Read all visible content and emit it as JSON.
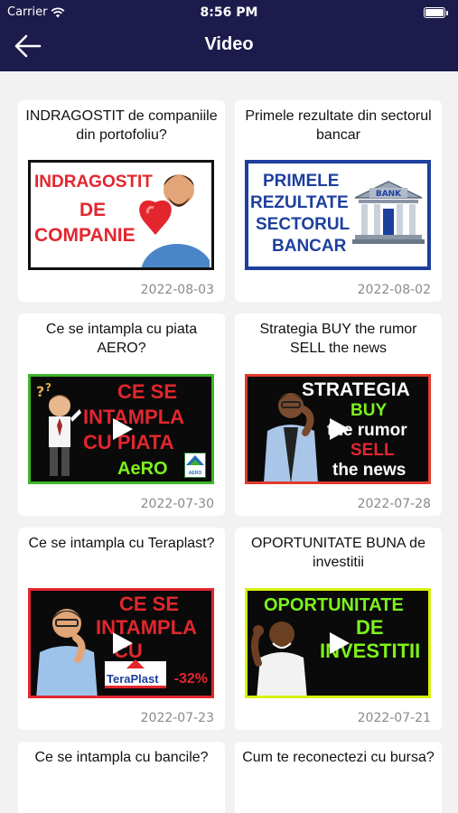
{
  "status_bar": {
    "carrier": "Carrier",
    "time": "8:56 PM",
    "battery_level": 0.9
  },
  "header": {
    "title": "Video",
    "back_icon": "arrow-left-icon"
  },
  "videos": [
    {
      "title": "INDRAGOSTIT de companiile din portofoliu?",
      "date": "2022-08-03",
      "thumb_lines": [
        "INDRAGOSTIT",
        "DE",
        "COMPANIE"
      ]
    },
    {
      "title": "Primele rezultate din sectorul bancar",
      "date": "2022-08-02",
      "thumb_lines": [
        "PRIMELE",
        "REZULTATE",
        "SECTORUL",
        "BANCAR",
        "BANK"
      ]
    },
    {
      "title": "Ce se intampla cu piata AERO?",
      "date": "2022-07-30",
      "thumb_lines": [
        "CE SE",
        "INTAMPLA",
        "CU PIATA",
        "AeRO",
        "AERO"
      ]
    },
    {
      "title": "Strategia BUY the rumor SELL the news",
      "date": "2022-07-28",
      "thumb_lines": [
        "STRATEGIA",
        "BUY",
        "the rumor",
        "SELL",
        "the news"
      ]
    },
    {
      "title": "Ce se intampla cu Teraplast?",
      "date": "2022-07-23",
      "thumb_lines": [
        "CE SE",
        "INTAMPLA",
        "CU",
        "TeraPlast",
        "-32%"
      ]
    },
    {
      "title": "OPORTUNITATE BUNA de investitii",
      "date": "2022-07-21",
      "thumb_lines": [
        "OPORTUNITATE",
        "DE",
        "INVESTITII"
      ]
    },
    {
      "title": "Ce se intampla cu bancile?"
    },
    {
      "title": "Cum te reconectezi cu bursa?"
    }
  ],
  "colors": {
    "header_bg": "#1c1b4b",
    "page_bg": "#f2f2f2",
    "accent_red": "#e3262e",
    "accent_green": "#7cf21b",
    "accent_blue": "#1d3f9e"
  }
}
